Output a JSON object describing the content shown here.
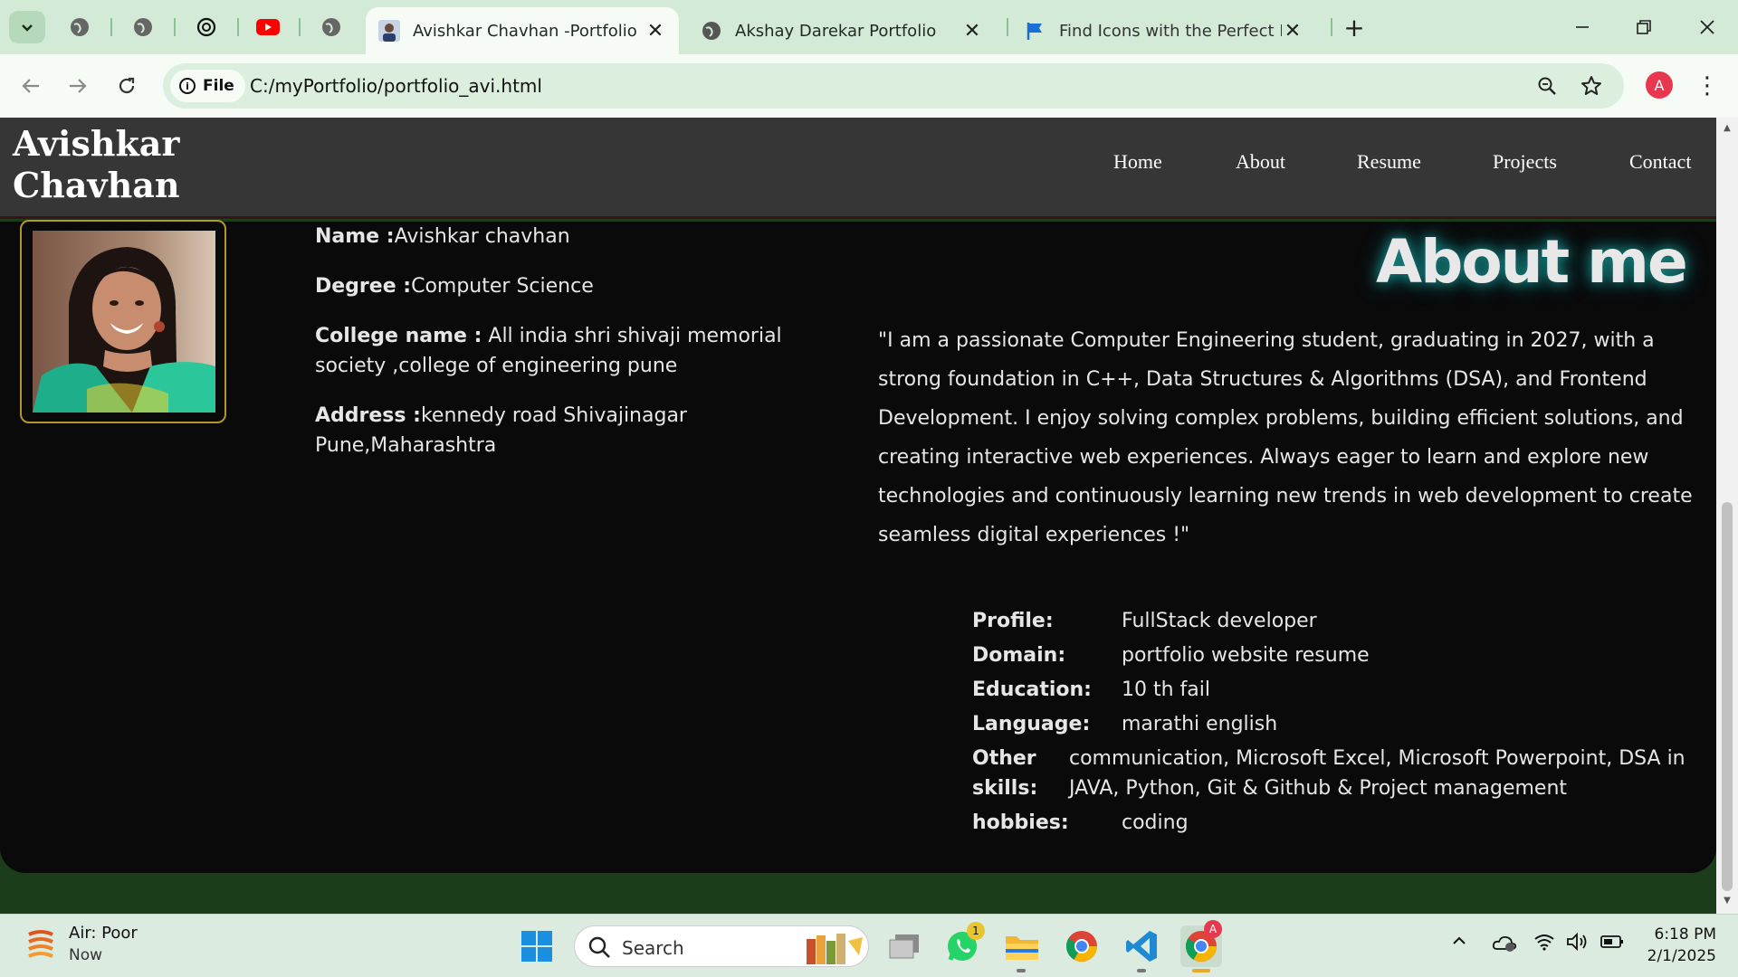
{
  "browser": {
    "tabs": [
      {
        "title": "Avishkar Chavhan -Portfolio",
        "active": true
      },
      {
        "title": "Akshay Darekar Portfolio",
        "active": false
      },
      {
        "title": "Find Icons with the Perfect Look",
        "active": false
      }
    ],
    "chip_label": "File",
    "url": "C:/myPortfolio/portfolio_avi.html",
    "profile_initial": "A"
  },
  "site": {
    "brand_line1": "Avishkar",
    "brand_line2": "Chavhan",
    "nav": [
      "Home",
      "About",
      "Resume",
      "Projects",
      "Contact"
    ]
  },
  "personal": {
    "name_label": "Name :",
    "name_value": "Avishkar chavhan",
    "degree_label": "Degree :",
    "degree_value": "Computer Science",
    "college_label": "College name :",
    "college_value": " All india shri shivaji memorial society ,college of engineering pune",
    "address_label": "Address :",
    "address_value": "kennedy road Shivajinagar Pune,Maharashtra"
  },
  "about": {
    "title": "About me",
    "text": "\"I am a passionate Computer Engineering student, graduating in 2027, with a strong foundation in C++, Data Structures & Algorithms (DSA), and Frontend Development. I enjoy solving complex problems, building efficient solutions, and creating interactive web experiences. Always eager to learn and explore new technologies and continuously learning new trends in web development to create seamless digital experiences !\""
  },
  "details": [
    {
      "label": "Profile:",
      "value": "FullStack developer"
    },
    {
      "label": "Domain:",
      "value": "portfolio website resume"
    },
    {
      "label": "Education:",
      "value": "10 th fail"
    },
    {
      "label": "Language:",
      "value": "marathi english"
    },
    {
      "label": "Other skills:",
      "value": "communication, Microsoft Excel, Microsoft Powerpoint, DSA in JAVA, Python, Git & Github & Project management"
    },
    {
      "label": "hobbies:",
      "value": "coding"
    }
  ],
  "taskbar": {
    "weather_title": "Air: Poor",
    "weather_sub": "Now",
    "search_placeholder": "Search",
    "whatsapp_badge": "1",
    "chrome_badge": "A",
    "time": "6:18 PM",
    "date": "2/1/2025"
  },
  "colors": {
    "tabbar": "#d3ead6",
    "site_header": "#363636",
    "panel": "#0a0a0b",
    "page_bg": "#1b3d1a",
    "photo_border": "#b3962a",
    "title_glow": "#1a8a8a"
  }
}
